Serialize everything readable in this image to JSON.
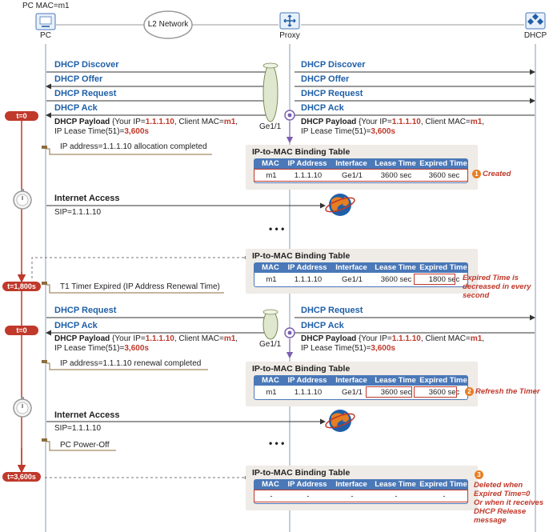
{
  "top_label": "PC MAC=m1",
  "devices": {
    "pc": "PC",
    "l2": "L2 Network",
    "proxy": "Proxy",
    "dhcp": "DHCP"
  },
  "port_label": "Ge1/1",
  "msgs": {
    "discover": "DHCP Discover",
    "offer": "DHCP Offer",
    "request": "DHCP Request",
    "ack": "DHCP Ack"
  },
  "payload": {
    "title": "DHCP Payload",
    "p1": " {Your IP=",
    "ip": "1.1.1.10",
    "p2": ", Client MAC=",
    "mac": "m1",
    "p3": ",",
    "p4": "IP Lease Time(51)=",
    "lease": "3,600s"
  },
  "timeline": [
    "t=0",
    "t=1,800s",
    "t=0",
    "t=3,600s"
  ],
  "notes": {
    "alloc": "IP address=1.1.1.10 allocation completed",
    "t1": "T1 Timer Expired (IP Address Renewal Time)",
    "renew": "IP address=1.1.1.10 renewal completed",
    "poweroff": "PC Power-Off"
  },
  "internet": {
    "title": "Internet Access",
    "sip": "SIP=1.1.1.10"
  },
  "ellipsis": "• • •",
  "table": {
    "title": "IP-to-MAC Binding Table",
    "headers": [
      "MAC",
      "IP Address",
      "Interface",
      "Lease Time",
      "Expired Time"
    ],
    "rows": [
      [
        "m1",
        "1.1.1.10",
        "Ge1/1",
        "3600 sec",
        "3600 sec"
      ],
      [
        "m1",
        "1.1.1.10",
        "Ge1/1",
        "3600 sec",
        "1800 sec"
      ],
      [
        "m1",
        "1.1.1.10",
        "Ge1/1",
        "3600 sec",
        "3600 sec"
      ],
      [
        "-",
        "-",
        "-",
        "-",
        "-"
      ]
    ]
  },
  "annotations": {
    "n1": "1",
    "created": "Created",
    "expired_dec": [
      "Expired Time is",
      "decreased in every",
      "second"
    ],
    "n2": "2",
    "refresh": "Refresh the Timer",
    "n3": "3",
    "deleted": [
      "Deleted when",
      "Expired Time=0",
      "Or when it receives",
      "DHCP Release",
      "message"
    ]
  },
  "colors": {
    "accent_red": "#c0392b",
    "msg_blue": "#1f5fa8",
    "table_head": "#4a78b8",
    "badge_orange": "#e67e22"
  }
}
